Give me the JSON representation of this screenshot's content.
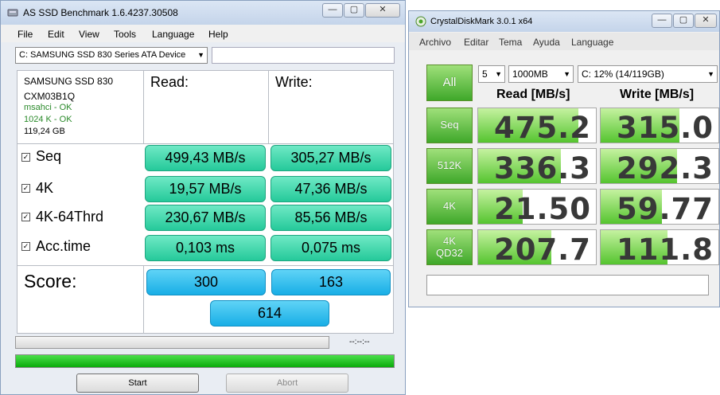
{
  "asssd": {
    "title": "AS SSD Benchmark 1.6.4237.30508",
    "menu": [
      "File",
      "Edit",
      "View",
      "Tools",
      "Language",
      "Help"
    ],
    "drive_select": "C: SAMSUNG SSD 830 Series ATA Device",
    "info": {
      "model": "SAMSUNG SSD 830",
      "firmware": "CXM03B1Q",
      "driver": "msahci - OK",
      "alignment": "1024 K - OK",
      "size": "119,24 GB"
    },
    "read_header": "Read:",
    "write_header": "Write:",
    "rows": [
      {
        "label": "Seq",
        "read": "499,43 MB/s",
        "write": "305,27 MB/s"
      },
      {
        "label": "4K",
        "read": "19,57 MB/s",
        "write": "47,36 MB/s"
      },
      {
        "label": "4K-64Thrd",
        "read": "230,67 MB/s",
        "write": "85,56 MB/s"
      },
      {
        "label": "Acc.time",
        "read": "0,103 ms",
        "write": "0,075 ms"
      }
    ],
    "score_label": "Score:",
    "score_read": "300",
    "score_write": "163",
    "score_total": "614",
    "time_display": "--:--:--",
    "progress_fraction": 1.0,
    "start_label": "Start",
    "abort_label": "Abort"
  },
  "cdm": {
    "title": "CrystalDiskMark 3.0.1 x64",
    "menu": [
      "Archivo",
      "Editar",
      "Tema",
      "Ayuda",
      "Language"
    ],
    "all_label": "All",
    "count_select": "5",
    "size_select": "1000MB",
    "drive_select": "C: 12% (14/119GB)",
    "read_header": "Read [MB/s]",
    "write_header": "Write [MB/s]",
    "rows": [
      {
        "label": "Seq",
        "read": "475.2",
        "write": "315.0",
        "read_fill": 0.85,
        "write_fill": 0.67
      },
      {
        "label": "512K",
        "read": "336.3",
        "write": "292.3",
        "read_fill": 0.7,
        "write_fill": 0.65
      },
      {
        "label": "4K",
        "read": "21.50",
        "write": "59.77",
        "read_fill": 0.38,
        "write_fill": 0.52
      },
      {
        "label_line1": "4K",
        "label_line2": "QD32",
        "read": "207.7",
        "write": "111.8",
        "read_fill": 0.62,
        "write_fill": 0.57
      }
    ]
  }
}
